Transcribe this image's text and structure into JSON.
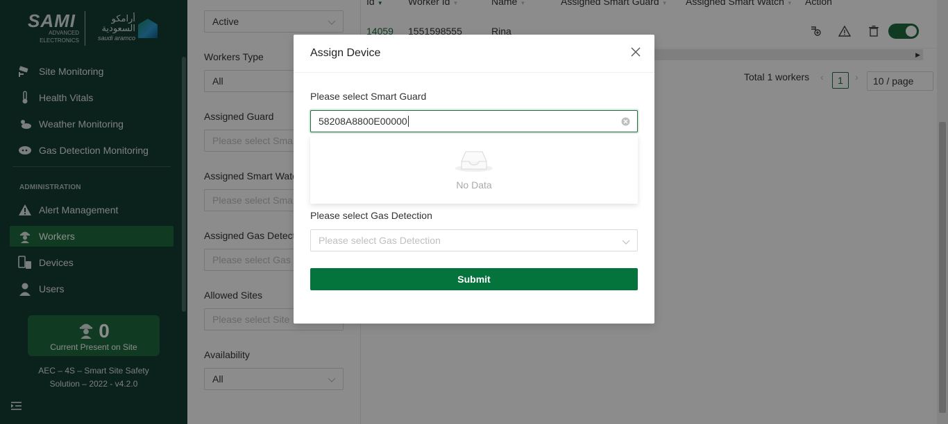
{
  "sidebar": {
    "logo": {
      "brand": "SAMI",
      "sub1": "ADVANCED",
      "sub2": "ELECTRONICS",
      "arabic": "أرامكو السعودية",
      "latin": "saudi aramco"
    },
    "items": [
      {
        "label": "Site Monitoring",
        "icon": "cctv-icon"
      },
      {
        "label": "Health Vitals",
        "icon": "thermometer-icon"
      },
      {
        "label": "Weather Monitoring",
        "icon": "weather-icon"
      },
      {
        "label": "Gas Detection Monitoring",
        "icon": "cloud-gas-icon"
      }
    ],
    "admin_heading": "ADMINISTRATION",
    "admin_items": [
      {
        "label": "Alert Management",
        "icon": "alert-icon"
      },
      {
        "label": "Workers",
        "icon": "worker-icon",
        "active": true
      },
      {
        "label": "Devices",
        "icon": "devices-icon"
      },
      {
        "label": "Users",
        "icon": "user-icon"
      }
    ],
    "present": {
      "count": "0",
      "label": "Current Present on Site"
    },
    "footer": "AEC – 4S – Smart Site Safety Solution – 2022 - v4.2.0"
  },
  "filters": {
    "status": {
      "value": "Active"
    },
    "workers_type": {
      "label": "Workers Type",
      "value": "All"
    },
    "assigned_guard": {
      "label": "Assigned Guard",
      "placeholder": "Please select Smart Guard"
    },
    "assigned_watch": {
      "label": "Assigned Smart Watch",
      "placeholder": "Please select Smart Watch"
    },
    "assigned_gas": {
      "label": "Assigned Gas Detection",
      "placeholder": "Please select Gas Detection"
    },
    "allowed_sites": {
      "label": "Allowed Sites",
      "placeholder": "Please select Site"
    },
    "availability": {
      "label": "Availability",
      "value": "All"
    }
  },
  "table": {
    "columns": [
      "Id",
      "Worker Id",
      "Name",
      "Assigned Smart Guard",
      "Assigned Smart Watch",
      "Action"
    ],
    "rows": [
      {
        "id": "14059",
        "worker_id": "1551598555",
        "name": "Rina"
      }
    ],
    "total": "Total 1 workers",
    "page": "1",
    "page_size": "10 / page"
  },
  "modal": {
    "title": "Assign Device",
    "guard_label": "Please select Smart Guard",
    "guard_value": "58208A8800E00000",
    "no_data": "No Data",
    "gas_label": "Please select Gas Detection",
    "gas_placeholder": "Please select Gas Detection",
    "submit": "Submit"
  },
  "colors": {
    "sidebar_bg": "#143c34",
    "accent": "#1e6b3e",
    "submit": "#05743c"
  }
}
